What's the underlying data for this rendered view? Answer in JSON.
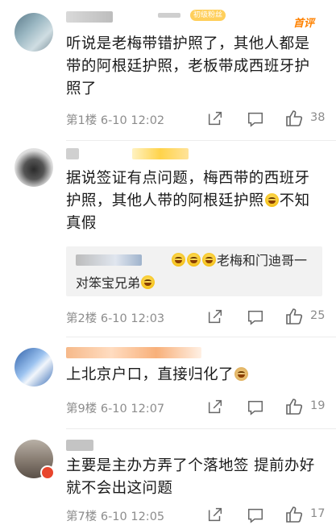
{
  "comments": [
    {
      "text": "听说是老梅带错护照了，其他人都是带的阿根廷护照，老板带成西班牙护照了",
      "floor": "第1楼",
      "time": "6-10 12:02",
      "likes": "38",
      "badge": "初级粉丝",
      "tag": "首评"
    },
    {
      "text": "据说签证有点问题，梅西带的西班牙护照，其他人带的阿根廷护照",
      "text_after_emoji": "不知真假",
      "floor": "第2楼",
      "time": "6-10 12:03",
      "likes": "25",
      "reply": {
        "text": "老梅和门迪哥一对笨宝兄弟"
      }
    },
    {
      "text": "上北京户口，直接归化了",
      "floor": "第9楼",
      "time": "6-10 12:07",
      "likes": "19"
    },
    {
      "text": "主要是主办方弄了个落地签 提前办好就不会出这问题",
      "floor": "第7楼",
      "time": "6-10 12:05",
      "likes": "17"
    }
  ],
  "icons": {
    "share": "share-icon",
    "reply": "comment-icon",
    "like": "thumbs-up-icon"
  },
  "colors": {
    "meta": "#8c8c8c",
    "accent": "#ff8200"
  }
}
